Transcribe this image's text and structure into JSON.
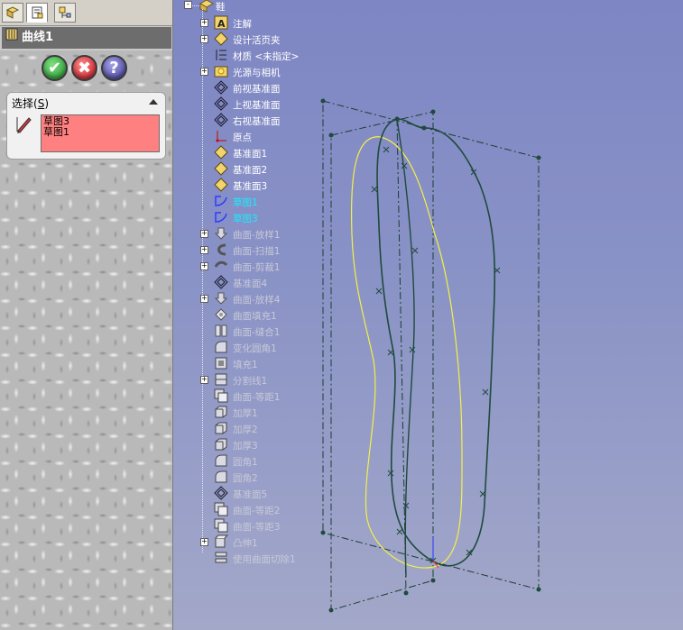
{
  "panel": {
    "tabs": [
      "feature-manager-tab",
      "property-manager-tab",
      "configuration-manager-tab"
    ],
    "title": "曲线1",
    "buttons": {
      "ok": "✔",
      "cancel": "✖",
      "help": "?"
    },
    "selection": {
      "header": "选择(S)",
      "items": [
        "草图3",
        "草图1"
      ]
    }
  },
  "tree": {
    "root": "鞋",
    "items": [
      {
        "label": "注解",
        "icon": "annotation-icon",
        "expand": true,
        "state": "normal"
      },
      {
        "label": "设计活页夹",
        "icon": "design-binder-icon",
        "expand": true,
        "state": "normal"
      },
      {
        "label": "材质 <未指定>",
        "icon": "material-icon",
        "expand": false,
        "state": "normal"
      },
      {
        "label": "光源与相机",
        "icon": "lights-icon",
        "expand": true,
        "state": "normal"
      },
      {
        "label": "前视基准面",
        "icon": "plane-icon",
        "expand": false,
        "state": "normal"
      },
      {
        "label": "上视基准面",
        "icon": "plane-icon",
        "expand": false,
        "state": "normal"
      },
      {
        "label": "右视基准面",
        "icon": "plane-icon",
        "expand": false,
        "state": "normal"
      },
      {
        "label": "原点",
        "icon": "origin-icon",
        "expand": false,
        "state": "normal"
      },
      {
        "label": "基准面1",
        "icon": "plane-yellow-icon",
        "expand": false,
        "state": "normal"
      },
      {
        "label": "基准面2",
        "icon": "plane-yellow-icon",
        "expand": false,
        "state": "normal"
      },
      {
        "label": "基准面3",
        "icon": "plane-yellow-icon",
        "expand": false,
        "state": "normal"
      },
      {
        "label": "草图1",
        "icon": "sketch-icon",
        "expand": false,
        "state": "selected"
      },
      {
        "label": "草图3",
        "icon": "sketch-icon",
        "expand": false,
        "state": "selected"
      },
      {
        "label": "曲面-放样1",
        "icon": "loft-icon",
        "expand": true,
        "state": "suppressed"
      },
      {
        "label": "曲面-扫描1",
        "icon": "sweep-icon",
        "expand": true,
        "state": "suppressed"
      },
      {
        "label": "曲面-剪裁1",
        "icon": "trim-icon",
        "expand": true,
        "state": "suppressed"
      },
      {
        "label": "基准面4",
        "icon": "plane-icon",
        "expand": false,
        "state": "suppressed"
      },
      {
        "label": "曲面-放样4",
        "icon": "loft-icon",
        "expand": true,
        "state": "suppressed"
      },
      {
        "label": "曲面填充1",
        "icon": "fill-icon",
        "expand": false,
        "state": "suppressed"
      },
      {
        "label": "曲面-缝合1",
        "icon": "knit-icon",
        "expand": false,
        "state": "suppressed"
      },
      {
        "label": "变化圆角1",
        "icon": "fillet-icon",
        "expand": false,
        "state": "suppressed"
      },
      {
        "label": "填充1",
        "icon": "fill-pattern-icon",
        "expand": false,
        "state": "suppressed"
      },
      {
        "label": "分割线1",
        "icon": "split-line-icon",
        "expand": true,
        "state": "suppressed"
      },
      {
        "label": "曲面-等距1",
        "icon": "offset-icon",
        "expand": false,
        "state": "suppressed"
      },
      {
        "label": "加厚1",
        "icon": "thicken-icon",
        "expand": false,
        "state": "suppressed"
      },
      {
        "label": "加厚2",
        "icon": "thicken-icon",
        "expand": false,
        "state": "suppressed"
      },
      {
        "label": "加厚3",
        "icon": "thicken-icon",
        "expand": false,
        "state": "suppressed"
      },
      {
        "label": "圆角1",
        "icon": "fillet-icon",
        "expand": false,
        "state": "suppressed"
      },
      {
        "label": "圆角2",
        "icon": "fillet-icon",
        "expand": false,
        "state": "suppressed"
      },
      {
        "label": "基准面5",
        "icon": "plane-icon",
        "expand": false,
        "state": "suppressed"
      },
      {
        "label": "曲面-等距2",
        "icon": "offset-icon",
        "expand": false,
        "state": "suppressed"
      },
      {
        "label": "曲面-等距3",
        "icon": "offset-icon",
        "expand": false,
        "state": "suppressed"
      },
      {
        "label": "凸伸1",
        "icon": "boss-extrude-icon",
        "expand": true,
        "state": "suppressed"
      },
      {
        "label": "使用曲面切除1",
        "icon": "surface-cut-icon",
        "expand": false,
        "state": "suppressed"
      }
    ]
  },
  "colors": {
    "viewport": "#8a93c6",
    "selected_text": "#13f0ff",
    "selection_list": "#ff8080",
    "sketch_curve": "#1f4a3c",
    "yellow_curve": "#f4f046"
  }
}
